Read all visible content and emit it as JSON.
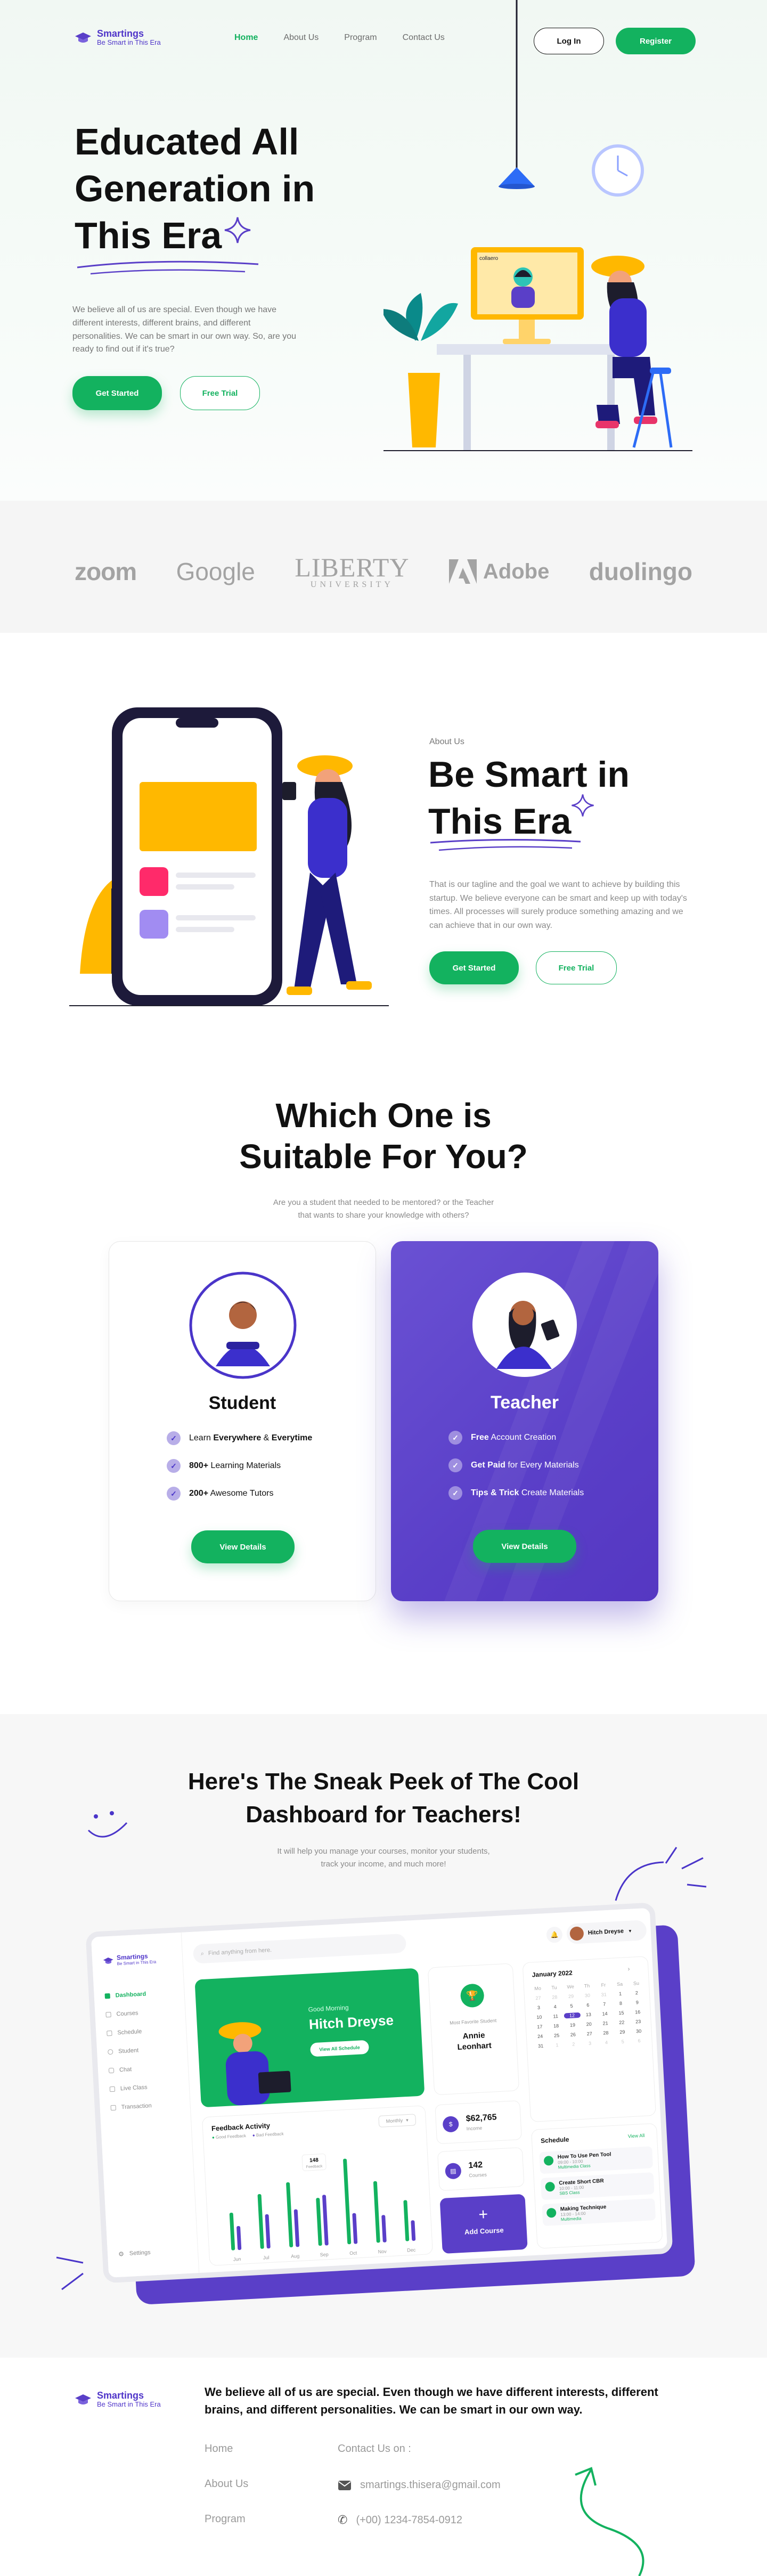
{
  "header": {
    "brand": "Smartings",
    "tagline": "Be Smart in This Era",
    "nav": [
      "Home",
      "About Us",
      "Program",
      "Contact Us"
    ],
    "login": "Log In",
    "register": "Register"
  },
  "hero": {
    "title": "Educated All Generation in This Era",
    "text": "We believe all of us are special. Even though we have different interests, different brains, and different personalities. We can be smart in our own way. So, are you ready to find out if it's true?",
    "cta_primary": "Get Started",
    "cta_secondary": "Free Trial",
    "video_label": "collaero"
  },
  "brands": [
    "zoom",
    "Google",
    "LIBERTY",
    "UNIVERSITY",
    "Adobe",
    "duolingo"
  ],
  "about": {
    "eyebrow": "About Us",
    "title": "Be Smart in This Era",
    "text": "That is our tagline and the goal we want to achieve by building this startup. We believe everyone can be smart and keep up with today's times. All processes will surely produce something amazing and we can achieve that in our own way.",
    "cta_primary": "Get Started",
    "cta_secondary": "Free Trial"
  },
  "choose": {
    "title_line1": "Which One is",
    "title_line2": "Suitable For You?",
    "subtitle_line1": "Are you a student that needed to be mentored? or the Teacher",
    "subtitle_line2": "that wants to share your knowledge with others?",
    "student": {
      "title": "Student",
      "features": [
        {
          "pre": "Learn ",
          "bold": "Everywhere",
          "mid": " & ",
          "bold2": "Everytime",
          "post": ""
        },
        {
          "pre": "",
          "bold": "800+",
          "mid": " Learning Materials",
          "bold2": "",
          "post": ""
        },
        {
          "pre": "",
          "bold": "200+",
          "mid": " Awesome Tutors",
          "bold2": "",
          "post": ""
        }
      ],
      "button": "View Details"
    },
    "teacher": {
      "title": "Teacher",
      "features": [
        {
          "pre": "",
          "bold": "Free",
          "mid": " Account Creation",
          "bold2": "",
          "post": ""
        },
        {
          "pre": "",
          "bold": "Get Paid",
          "mid": " for Every Materials",
          "bold2": "",
          "post": ""
        },
        {
          "pre": "",
          "bold": "Tips & Trick",
          "mid": " Create Materials",
          "bold2": "",
          "post": ""
        }
      ],
      "button": "View Details"
    }
  },
  "peek": {
    "title_line1": "Here's The Sneak Peek of The Cool",
    "title_line2": "Dashboard for Teachers!",
    "subtitle_line1": "It will help you manage your courses, monitor your students,",
    "subtitle_line2": "track your income, and much more!"
  },
  "dashboard": {
    "brand": "Smartings",
    "tagline": "Be Smart in This Era",
    "search_placeholder": "Find anything from here.",
    "user": "Hitch Dreyse",
    "menu": [
      "Dashboard",
      "Courses",
      "Schedule",
      "Student",
      "Chat",
      "Live Class",
      "Transaction"
    ],
    "settings": "Settings",
    "greeting": "Good Morning",
    "greeting_name": "Hitch Dreyse",
    "view_schedule": "View All Schedule",
    "fav_label": "Most Favorite Student",
    "fav_name_1": "Annie",
    "fav_name_2": "Leonhart",
    "income": "$62,765",
    "income_label": "Income",
    "courses": "142",
    "courses_label": "Courses",
    "add_course": "Add Course",
    "chart_title": "Feedback Activity",
    "legend": [
      "Good Feedback",
      "Bad Feedback"
    ],
    "period": "Monthly",
    "months": [
      "Jun",
      "Jul",
      "Aug",
      "Sep",
      "Oct",
      "Nov",
      "Dec"
    ],
    "tooltip": "148",
    "tooltip_sub": "Feedback",
    "calendar_title": "January 2022",
    "weekdays": [
      "Mo",
      "Tu",
      "We",
      "Th",
      "Fr",
      "Sa",
      "Su"
    ],
    "calendar_days": [
      "27",
      "28",
      "29",
      "30",
      "31",
      "1",
      "2",
      "3",
      "4",
      "5",
      "6",
      "7",
      "8",
      "9",
      "10",
      "11",
      "12",
      "13",
      "14",
      "15",
      "16",
      "17",
      "18",
      "19",
      "20",
      "21",
      "22",
      "23",
      "24",
      "25",
      "26",
      "27",
      "28",
      "29",
      "30",
      "31",
      "1",
      "2",
      "3",
      "4",
      "5",
      "6"
    ],
    "calendar_selected": "12",
    "schedule_title": "Schedule",
    "schedule_view_all": "View All",
    "schedule": [
      {
        "title": "How To Use Pen Tool",
        "time": "09:00 - 10:00",
        "tag": "Multimedia Class"
      },
      {
        "title": "Create Short CBR",
        "time": "10:00 - 11:00",
        "tag": "SBS Class"
      },
      {
        "title": "Making Technique",
        "time": "13:00 - 14:00",
        "tag": "Multimedia"
      }
    ]
  },
  "chart_data": {
    "type": "bar",
    "title": "Feedback Activity",
    "categories": [
      "Jun",
      "Jul",
      "Aug",
      "Sep",
      "Oct",
      "Nov",
      "Dec"
    ],
    "series": [
      {
        "name": "Good Feedback",
        "values": [
          110,
          160,
          190,
          140,
          250,
          180,
          120
        ]
      },
      {
        "name": "Bad Feedback",
        "values": [
          70,
          100,
          110,
          148,
          90,
          80,
          60
        ]
      }
    ],
    "colors": {
      "Good Feedback": "#13b25f",
      "Bad Feedback": "#5a3fc8"
    }
  },
  "footer": {
    "brand": "Smartings",
    "tagline": "Be Smart in This Era",
    "statement": "We believe all of us are special. Even though we have different interests, different brains, and different personalities. We can be smart in our own way.",
    "links": [
      "Home",
      "About Us",
      "Program"
    ],
    "contact_title": "Contact Us on :",
    "email": "smartings.thisera@gmail.com",
    "phone": "(+00) 1234-7854-0912"
  },
  "colors": {
    "green": "#13b25f",
    "purple": "#5a3fc8",
    "yellow": "#ffb800"
  }
}
